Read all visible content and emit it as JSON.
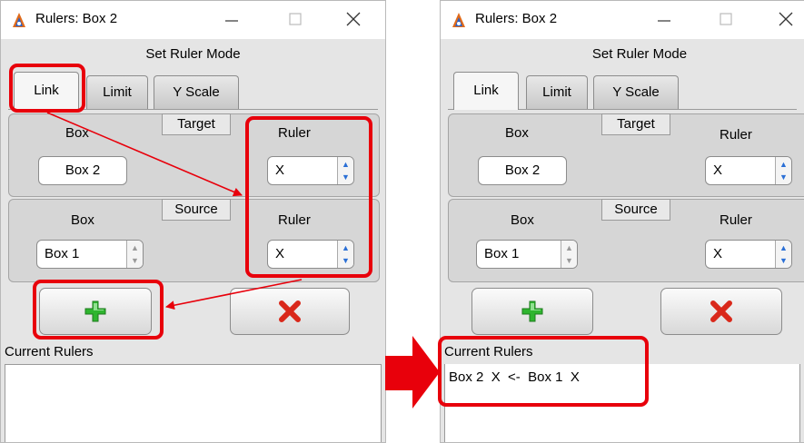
{
  "windows": [
    {
      "title": "Rulers: Box 2",
      "mode_label": "Set Ruler Mode",
      "tabs": [
        "Link",
        "Limit",
        "Y Scale"
      ],
      "target": {
        "group_title": "Target",
        "box_label": "Box",
        "box_value": "Box 2",
        "ruler_label": "Ruler",
        "ruler_value": "X"
      },
      "source": {
        "group_title": "Source",
        "box_label": "Box",
        "box_value": "Box 1",
        "ruler_label": "Ruler",
        "ruler_value": "X"
      },
      "current_rulers_label": "Current Rulers",
      "current_rulers": []
    },
    {
      "title": "Rulers: Box 2",
      "mode_label": "Set Ruler Mode",
      "tabs": [
        "Link",
        "Limit",
        "Y Scale"
      ],
      "target": {
        "group_title": "Target",
        "box_label": "Box",
        "box_value": "Box 2",
        "ruler_label": "Ruler",
        "ruler_value": "X"
      },
      "source": {
        "group_title": "Source",
        "box_label": "Box",
        "box_value": "Box 1",
        "ruler_label": "Ruler",
        "ruler_value": "X"
      },
      "current_rulers_label": "Current Rulers",
      "current_rulers": [
        "Box 2  X  <-  Box 1  X"
      ]
    }
  ],
  "colors": {
    "highlight": "#e8000b",
    "add": "#2fb52f",
    "delete": "#d9281a",
    "window_bg": "#e5e5e5"
  },
  "icons": {
    "app": "app-logo-icon",
    "add": "plus-icon",
    "delete": "x-icon",
    "transition": "right-arrow-icon"
  }
}
